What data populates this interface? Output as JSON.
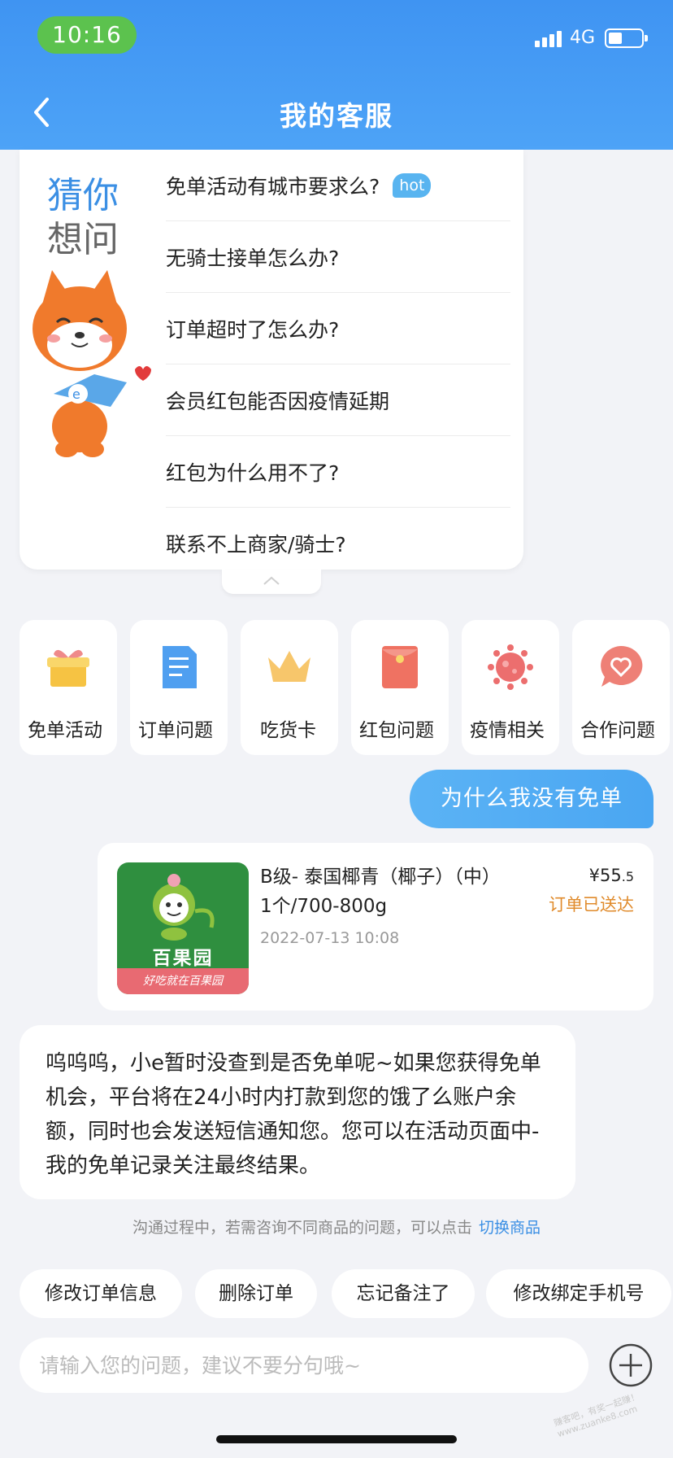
{
  "status_bar": {
    "time": "10:16",
    "network": "4G",
    "icons": [
      "signal-icon",
      "battery-icon"
    ]
  },
  "header": {
    "title": "我的客服",
    "back_icon": "chevron-left-icon",
    "background": "#4a9ff5"
  },
  "guess": {
    "title_line1": "猜你",
    "title_line2": "想问",
    "mascot": "fox-mascot",
    "questions": [
      {
        "text": "免单活动有城市要求么?",
        "badge": "hot"
      },
      {
        "text": "无骑士接单怎么办?"
      },
      {
        "text": "订单超时了怎么办?"
      },
      {
        "text": "会员红包能否因疫情延期"
      },
      {
        "text": "红包为什么用不了?"
      },
      {
        "text": "联系不上商家/骑士?"
      }
    ],
    "collapse_icon": "chevron-up-icon"
  },
  "categories": [
    {
      "label": "免单活动",
      "icon": "gift-icon"
    },
    {
      "label": "订单问题",
      "icon": "document-icon"
    },
    {
      "label": "吃货卡",
      "icon": "crown-icon"
    },
    {
      "label": "红包问题",
      "icon": "red-envelope-icon"
    },
    {
      "label": "疫情相关",
      "icon": "virus-icon"
    },
    {
      "label": "合作问题",
      "icon": "heart-chat-icon"
    }
  ],
  "chat": {
    "user_message": "为什么我没有免单",
    "order": {
      "brand": "百果园",
      "slogan": "好吃就在百果园",
      "name_line1": "B级- 泰国椰青（椰子）（中）",
      "name_line2": "1个/700-800g",
      "date": "2022-07-13 10:08",
      "price_symbol": "¥",
      "price_int": "55",
      "price_dec": ".5",
      "status": "订单已送达"
    },
    "bot_message": "呜呜呜，小e暂时没查到是否免单呢~如果您获得免单机会，平台将在24小时内打款到您的饿了么账户余额，同时也会发送短信通知您。您可以在活动页面中-我的免单记录关注最终结果。",
    "hint": "沟通过程中，若需咨询不同商品的问题，可以点击",
    "hint_link": "切换商品"
  },
  "quick_replies": [
    "修改订单信息",
    "删除订单",
    "忘记备注了",
    "修改绑定手机号"
  ],
  "input": {
    "placeholder": "请输入您的问题，建议不要分句哦~",
    "value": "",
    "plus_icon": "plus-circle-icon"
  },
  "watermark": "赚客吧，有奖一起赚！www.zuanke8.com",
  "colors": {
    "accent": "#3b8fe4",
    "status_orange": "#e08b2c",
    "background": "#f2f3f7"
  }
}
